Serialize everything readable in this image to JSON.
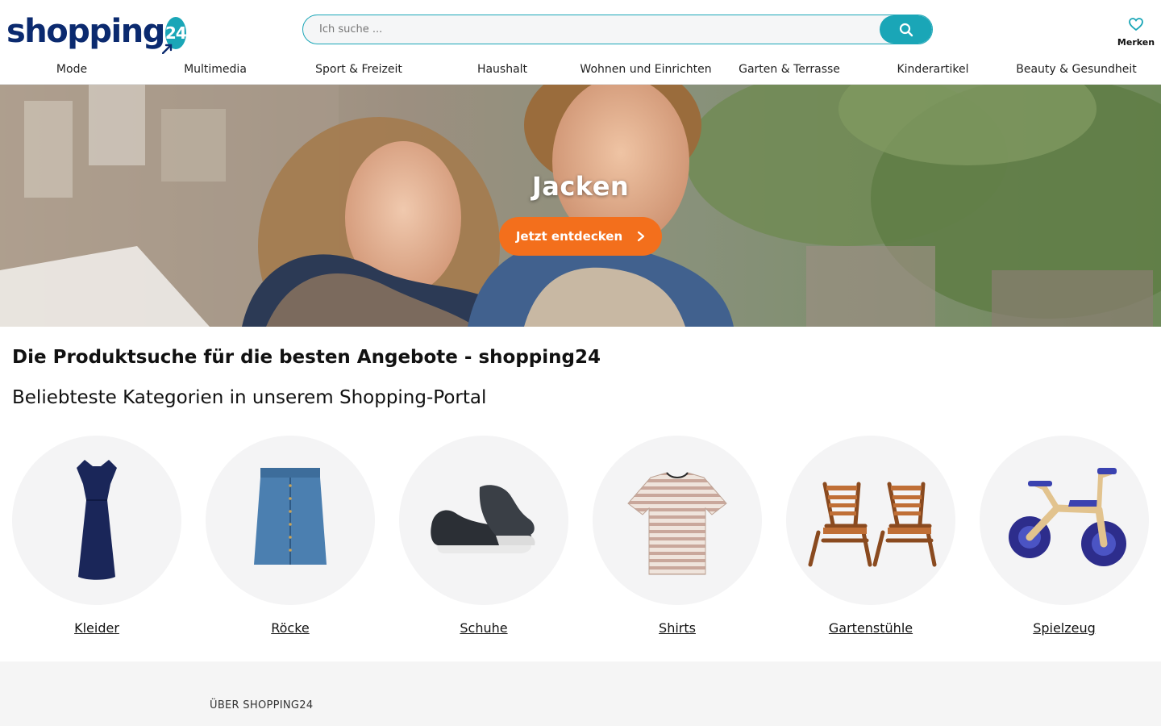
{
  "header": {
    "logo_text": "shopping",
    "logo_badge": "24",
    "search_placeholder": "Ich suche ...",
    "merken_label": "Merken"
  },
  "nav": {
    "items": [
      "Mode",
      "Multimedia",
      "Sport & Freizeit",
      "Haushalt",
      "Wohnen und Einrichten",
      "Garten & Terrasse",
      "Kinderartikel",
      "Beauty & Gesundheit"
    ]
  },
  "hero": {
    "title": "Jacken",
    "cta_label": "Jetzt entdecken"
  },
  "content": {
    "heading": "Die Produktsuche für die besten Angebote - shopping24",
    "subheading": "Beliebteste Kategorien in unserem Shopping-Portal",
    "categories": [
      {
        "label": "Kleider",
        "icon": "dress-image"
      },
      {
        "label": "Röcke",
        "icon": "denim-skirt-image"
      },
      {
        "label": "Schuhe",
        "icon": "sneaker-image"
      },
      {
        "label": "Shirts",
        "icon": "striped-shirt-image"
      },
      {
        "label": "Gartenstühle",
        "icon": "garden-chairs-image"
      },
      {
        "label": "Spielzeug",
        "icon": "balance-bike-image"
      }
    ]
  },
  "footer": {
    "heading": "ÜBER SHOPPING24"
  },
  "colors": {
    "brand_navy": "#0b2a6f",
    "brand_teal": "#1aa6b7",
    "cta_orange": "#f36f1c"
  }
}
